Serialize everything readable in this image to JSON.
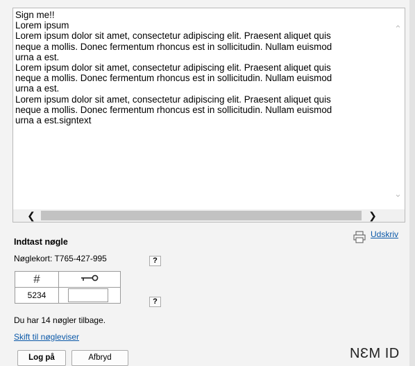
{
  "document": {
    "lines": [
      "Sign me!!",
      "Lorem ipsum",
      "Lorem ipsum dolor sit amet, consectetur adipiscing elit. Praesent aliquet quis",
      "neque a mollis. Donec fermentum rhoncus est in sollicitudin. Nullam euismod",
      "urna a est.",
      "Lorem ipsum dolor sit amet, consectetur adipiscing elit. Praesent aliquet quis",
      "neque a mollis. Donec fermentum rhoncus est in sollicitudin. Nullam euismod",
      "urna a est.",
      "Lorem ipsum dolor sit amet, consectetur adipiscing elit. Praesent aliquet quis",
      "neque a mollis. Donec fermentum rhoncus est in sollicitudin. Nullam euismod",
      "urna a est.signtext"
    ]
  },
  "print": {
    "label": "Udskriv",
    "icon": "printer-icon"
  },
  "key_entry": {
    "heading": "Indtast nøgle",
    "keycard_label": "Nøglekort: T765-427-995",
    "help_label": "?",
    "table_header_number": "#",
    "table_header_key_icon": "key-icon",
    "key_number": "5234",
    "key_value": "",
    "remaining": "Du har 14 nøgler tilbage.",
    "switch_link": "Skift til nøgleviser"
  },
  "buttons": {
    "login": "Log på",
    "cancel": "Afbryd"
  },
  "brand": {
    "logo_text": "NƐM ID"
  },
  "colors": {
    "link": "#0a58a8",
    "panel": "#f3f3f3"
  }
}
